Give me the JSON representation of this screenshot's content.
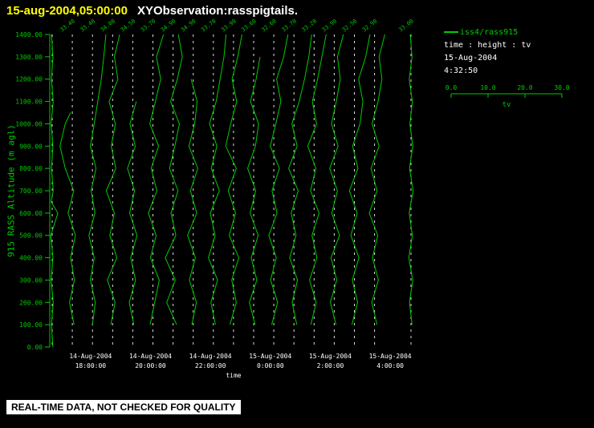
{
  "title": {
    "timestamp": "15-aug-2004,05:00:00",
    "text": "XYObservation:rasspigtails."
  },
  "colors": {
    "background": "#000000",
    "green": "#00cc00",
    "yellow": "#ffff00",
    "white": "#ffffff",
    "gridline": "#dddddd",
    "banner_bg": "#ffffff",
    "banner_text": "#000000"
  },
  "legend": {
    "series": "iss4/rass915",
    "mapping": "time : height : tv",
    "date": "15-Aug-2004",
    "time": "4:32:50"
  },
  "scalebar": {
    "tick_labels": [
      "0.0",
      "10.0",
      "20.0",
      "30.0"
    ],
    "min": 0,
    "max": 30,
    "label": "tv"
  },
  "banner": {
    "text": "REAL-TIME DATA, NOT CHECKED FOR QUALITY"
  },
  "axes": {
    "y_label": "915 RASS Altitude (m agl)",
    "x_label": "time",
    "y_tick_labels": [
      "0.00",
      "100.00",
      "200.00",
      "300.00",
      "400.00",
      "500.00",
      "600.00",
      "700.00",
      "800.00",
      "900.00",
      "1000.00",
      "1100.00",
      "1200.00",
      "1300.00",
      "1400.00"
    ],
    "x_ticks": [
      {
        "frac": 0.111,
        "date": "14-Aug-2004",
        "time": "18:00:00"
      },
      {
        "frac": 0.274,
        "date": "14-Aug-2004",
        "time": "20:00:00"
      },
      {
        "frac": 0.437,
        "date": "14-Aug-2004",
        "time": "22:00:00"
      },
      {
        "frac": 0.6,
        "date": "15-Aug-2004",
        "time": "0:00:00"
      },
      {
        "frac": 0.763,
        "date": "15-Aug-2004",
        "time": "2:00:00"
      },
      {
        "frac": 0.926,
        "date": "15-Aug-2004",
        "time": "4:00:00"
      }
    ]
  },
  "chart_data": {
    "type": "line",
    "title": "XYObservation:rasspigtails.",
    "xlabel": "time",
    "ylabel": "915 RASS Altitude (m agl)",
    "ylim": [
      0,
      1400
    ],
    "y_tick_step": 100,
    "tv_axis": {
      "min": 0,
      "max": 30,
      "label": "tv"
    },
    "series_name": "iss4/rass915",
    "profiles": [
      {
        "x_frac": 0.0066,
        "top_label": "",
        "points": [
          [
            0,
            0.2
          ],
          [
            100,
            -0.2
          ],
          [
            200,
            0.3
          ],
          [
            300,
            -0.3
          ],
          [
            400,
            0.2
          ],
          [
            500,
            -0.4
          ],
          [
            600,
            1.6
          ],
          [
            650,
            -0.3
          ],
          [
            700,
            0.3
          ],
          [
            800,
            -0.2
          ],
          [
            900,
            0.2
          ],
          [
            1000,
            -0.3
          ],
          [
            1100,
            0.3
          ],
          [
            1200,
            -0.2
          ],
          [
            1300,
            0.2
          ],
          [
            1400,
            -0.2
          ]
        ]
      },
      {
        "x_frac": 0.0613,
        "top_label": "33.40",
        "points": [
          [
            100,
            0.5
          ],
          [
            200,
            -0.8
          ],
          [
            300,
            0.6
          ],
          [
            400,
            -0.5
          ],
          [
            500,
            0.9
          ],
          [
            600,
            -1.2
          ],
          [
            700,
            0.4
          ],
          [
            800,
            -2.0
          ],
          [
            900,
            -3.5
          ],
          [
            1000,
            -2.0
          ],
          [
            1050,
            -0.5
          ]
        ]
      },
      {
        "x_frac": 0.1162,
        "top_label": "33.40",
        "points": [
          [
            100,
            0.0
          ],
          [
            200,
            0.8
          ],
          [
            300,
            -0.6
          ],
          [
            400,
            0.5
          ],
          [
            500,
            -1.0
          ],
          [
            600,
            0.7
          ],
          [
            700,
            -0.4
          ],
          [
            800,
            1.0
          ],
          [
            900,
            -0.6
          ],
          [
            1000,
            0.5
          ],
          [
            1100,
            1.5
          ],
          [
            1200,
            2.5
          ],
          [
            1300,
            3.2
          ],
          [
            1400,
            3.8
          ]
        ]
      },
      {
        "x_frac": 0.171,
        "top_label": "34.00",
        "points": [
          [
            100,
            -0.5
          ],
          [
            200,
            0.7
          ],
          [
            300,
            -1.5
          ],
          [
            400,
            1.2
          ],
          [
            500,
            -0.8
          ],
          [
            600,
            0.5
          ],
          [
            700,
            -1.8
          ],
          [
            800,
            0.9
          ],
          [
            900,
            -0.4
          ],
          [
            1000,
            0.8
          ],
          [
            1100,
            -1.0
          ],
          [
            1200,
            1.5
          ],
          [
            1300,
            0.5
          ],
          [
            1400,
            2.0
          ]
        ]
      },
      {
        "x_frac": 0.2258,
        "top_label": "34.50",
        "points": [
          [
            100,
            0.3
          ],
          [
            200,
            -1.0
          ],
          [
            300,
            0.8
          ],
          [
            400,
            -0.6
          ],
          [
            500,
            1.2
          ],
          [
            600,
            -0.9
          ],
          [
            700,
            0.5
          ],
          [
            800,
            -1.5
          ],
          [
            900,
            0.7
          ],
          [
            1000,
            -0.8
          ],
          [
            1100,
            1.0
          ]
        ]
      },
      {
        "x_frac": 0.2806,
        "top_label": "33.70",
        "points": [
          [
            100,
            -0.8
          ],
          [
            200,
            0.5
          ],
          [
            300,
            1.8
          ],
          [
            400,
            -0.7
          ],
          [
            500,
            0.9
          ],
          [
            600,
            -1.3
          ],
          [
            700,
            1.1
          ],
          [
            800,
            -0.5
          ],
          [
            900,
            1.6
          ],
          [
            1000,
            -0.9
          ],
          [
            1100,
            0.7
          ],
          [
            1200,
            2.2
          ],
          [
            1300,
            1.0
          ],
          [
            1400,
            3.0
          ]
        ]
      },
      {
        "x_frac": 0.3354,
        "top_label": "34.90",
        "points": [
          [
            100,
            1.0
          ],
          [
            200,
            -1.8
          ],
          [
            300,
            0.6
          ],
          [
            400,
            -2.2
          ],
          [
            500,
            0.8
          ],
          [
            600,
            -0.6
          ],
          [
            700,
            1.4
          ],
          [
            800,
            -1.0
          ],
          [
            900,
            0.5
          ],
          [
            1000,
            1.8
          ],
          [
            1100,
            -0.7
          ],
          [
            1200,
            1.2
          ],
          [
            1300,
            2.6
          ],
          [
            1400,
            1.5
          ]
        ]
      },
      {
        "x_frac": 0.3902,
        "top_label": "34.90",
        "points": [
          [
            100,
            -0.4
          ],
          [
            200,
            0.9
          ],
          [
            300,
            -1.1
          ],
          [
            400,
            0.6
          ],
          [
            500,
            -1.6
          ],
          [
            600,
            1.0
          ],
          [
            700,
            -0.8
          ],
          [
            800,
            1.3
          ],
          [
            900,
            -1.2
          ],
          [
            1000,
            0.4
          ],
          [
            1100,
            1.1
          ],
          [
            1200,
            -0.6
          ]
        ]
      },
      {
        "x_frac": 0.445,
        "top_label": "33.70",
        "points": [
          [
            100,
            0.6
          ],
          [
            200,
            -0.7
          ],
          [
            300,
            1.2
          ],
          [
            400,
            -1.4
          ],
          [
            500,
            0.5
          ],
          [
            600,
            -0.9
          ],
          [
            700,
            1.7
          ],
          [
            800,
            -0.6
          ],
          [
            900,
            1.0
          ],
          [
            1000,
            -1.1
          ],
          [
            1100,
            0.8
          ],
          [
            1200,
            1.9
          ],
          [
            1300,
            3.0
          ],
          [
            1400,
            3.6
          ]
        ]
      },
      {
        "x_frac": 0.4998,
        "top_label": "33.90",
        "points": [
          [
            100,
            -1.0
          ],
          [
            200,
            0.8
          ],
          [
            300,
            -0.5
          ],
          [
            400,
            1.5
          ],
          [
            500,
            -1.2
          ],
          [
            600,
            0.6
          ],
          [
            700,
            -1.5
          ],
          [
            800,
            0.8
          ],
          [
            900,
            -2.2
          ],
          [
            1000,
            -0.8
          ],
          [
            1100,
            0.9
          ],
          [
            1200,
            -0.4
          ],
          [
            1300,
            1.2
          ],
          [
            1400,
            2.4
          ]
        ]
      },
      {
        "x_frac": 0.5546,
        "top_label": "33.60",
        "points": [
          [
            100,
            0.4
          ],
          [
            200,
            -1.2
          ],
          [
            300,
            0.9
          ],
          [
            400,
            -0.7
          ],
          [
            500,
            1.3
          ],
          [
            600,
            -1.0
          ],
          [
            700,
            0.6
          ],
          [
            800,
            -1.7
          ],
          [
            900,
            0.5
          ],
          [
            1000,
            1.4
          ],
          [
            1100,
            -0.9
          ],
          [
            1200,
            0.7
          ],
          [
            1300,
            1.8
          ]
        ]
      },
      {
        "x_frac": 0.6094,
        "top_label": "32.60",
        "points": [
          [
            100,
            -0.6
          ],
          [
            200,
            1.1
          ],
          [
            300,
            -0.9
          ],
          [
            400,
            0.7
          ],
          [
            500,
            -1.4
          ],
          [
            600,
            0.9
          ],
          [
            700,
            -0.5
          ],
          [
            800,
            1.6
          ],
          [
            900,
            -1.0
          ],
          [
            1000,
            0.6
          ],
          [
            1100,
            2.0
          ],
          [
            1200,
            0.8
          ],
          [
            1300,
            2.8
          ],
          [
            1400,
            4.0
          ]
        ]
      },
      {
        "x_frac": 0.6642,
        "top_label": "33.70",
        "points": [
          [
            100,
            0.8
          ],
          [
            200,
            -0.5
          ],
          [
            300,
            1.0
          ],
          [
            400,
            -1.2
          ],
          [
            500,
            0.6
          ],
          [
            600,
            -0.8
          ],
          [
            700,
            1.2
          ],
          [
            800,
            -1.5
          ],
          [
            900,
            0.9
          ],
          [
            1000,
            -0.6
          ],
          [
            1100,
            1.5
          ],
          [
            1200,
            3.0
          ],
          [
            1300,
            4.2
          ],
          [
            1400,
            5.0
          ]
        ]
      },
      {
        "x_frac": 0.719,
        "top_label": "33.20",
        "points": [
          [
            100,
            -0.9
          ],
          [
            200,
            0.6
          ],
          [
            300,
            -1.3
          ],
          [
            400,
            0.8
          ],
          [
            500,
            -0.6
          ],
          [
            600,
            1.4
          ],
          [
            700,
            -1.0
          ],
          [
            800,
            0.5
          ],
          [
            900,
            -1.8
          ],
          [
            1000,
            0.7
          ],
          [
            1100,
            -0.5
          ],
          [
            1200,
            1.0
          ],
          [
            1300,
            2.2
          ],
          [
            1400,
            3.4
          ]
        ]
      },
      {
        "x_frac": 0.7738,
        "top_label": "33.90",
        "points": [
          [
            100,
            0.5
          ],
          [
            200,
            -1.1
          ],
          [
            300,
            0.7
          ],
          [
            400,
            -0.9
          ],
          [
            500,
            1.5
          ],
          [
            600,
            -0.7
          ],
          [
            700,
            0.9
          ],
          [
            800,
            -1.3
          ],
          [
            900,
            1.1
          ],
          [
            1000,
            -0.8
          ],
          [
            1100,
            0.6
          ],
          [
            1200,
            1.7
          ],
          [
            1300,
            0.9
          ],
          [
            1400,
            2.6
          ]
        ]
      },
      {
        "x_frac": 0.8286,
        "top_label": "32.50",
        "points": [
          [
            100,
            -0.7
          ],
          [
            200,
            0.9
          ],
          [
            300,
            -0.6
          ],
          [
            400,
            1.3
          ],
          [
            500,
            -1.0
          ],
          [
            600,
            0.8
          ],
          [
            700,
            -1.4
          ],
          [
            800,
            1.0
          ],
          [
            900,
            -0.5
          ],
          [
            1000,
            1.6
          ],
          [
            1100,
            2.4
          ],
          [
            1200,
            1.2
          ],
          [
            1300,
            3.2
          ],
          [
            1400,
            4.4
          ]
        ]
      },
      {
        "x_frac": 0.8834,
        "top_label": "32.90",
        "points": [
          [
            100,
            0.7
          ],
          [
            200,
            -0.8
          ],
          [
            300,
            1.1
          ],
          [
            400,
            -0.6
          ],
          [
            500,
            0.9
          ],
          [
            600,
            -1.5
          ],
          [
            700,
            0.7
          ],
          [
            800,
            -1.0
          ],
          [
            900,
            1.3
          ],
          [
            1000,
            -0.7
          ],
          [
            1100,
            1.0
          ],
          [
            1200,
            2.1
          ],
          [
            1300,
            1.3
          ],
          [
            1400,
            2.9
          ]
        ]
      },
      {
        "x_frac": 0.9825,
        "top_label": "33.00",
        "points": [
          [
            100,
            0.3
          ],
          [
            200,
            -0.4
          ],
          [
            300,
            0.5
          ],
          [
            400,
            -0.6
          ],
          [
            500,
            0.4
          ],
          [
            600,
            -0.5
          ],
          [
            700,
            0.6
          ],
          [
            800,
            -0.4
          ],
          [
            900,
            0.5
          ],
          [
            1000,
            -0.3
          ],
          [
            1100,
            0.4
          ],
          [
            1200,
            -0.5
          ],
          [
            1300,
            0.3
          ],
          [
            1400,
            -0.2
          ]
        ]
      }
    ]
  }
}
